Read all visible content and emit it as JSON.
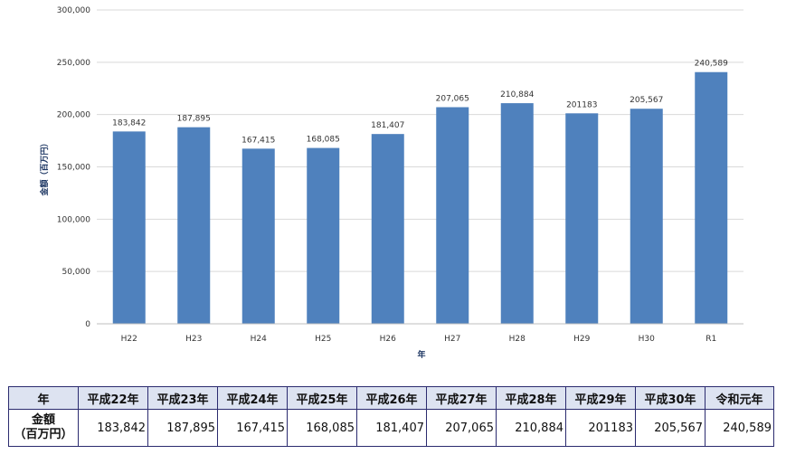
{
  "chart_data": {
    "type": "bar",
    "categories": [
      "H22",
      "H23",
      "H24",
      "H25",
      "H26",
      "H27",
      "H28",
      "H29",
      "H30",
      "R1"
    ],
    "values": [
      183842,
      187895,
      167415,
      168085,
      181407,
      207065,
      210884,
      201183,
      205567,
      240589
    ],
    "data_labels": [
      "183,842",
      "187,895",
      "167,415",
      "168,085",
      "181,407",
      "207,065",
      "210,884",
      "201183",
      "205,567",
      "240,589"
    ],
    "title": "",
    "xlabel": "年",
    "ylabel": "金額（百万円）",
    "ylim": [
      0,
      300000
    ],
    "yticks": [
      0,
      50000,
      100000,
      150000,
      200000,
      250000,
      300000
    ],
    "ytick_labels": [
      "0",
      "50,000",
      "100,000",
      "150,000",
      "200,000",
      "250,000",
      "300,000"
    ],
    "grid": true,
    "bar_color": "#4f81bd",
    "grid_color": "#d9d9d9"
  },
  "table": {
    "corner_header": "年",
    "years": [
      "平成22年",
      "平成23年",
      "平成24年",
      "平成25年",
      "平成26年",
      "平成27年",
      "平成28年",
      "平成29年",
      "平成30年",
      "令和元年"
    ],
    "row_label_line1": "金額",
    "row_label_line2": "（百万円）",
    "values": [
      "183,842",
      "187,895",
      "167,415",
      "168,085",
      "181,407",
      "207,065",
      "210,884",
      "201183",
      "205,567",
      "240,589"
    ],
    "header_bg": "#dde3f1",
    "border_color": "#2b2b6f"
  }
}
